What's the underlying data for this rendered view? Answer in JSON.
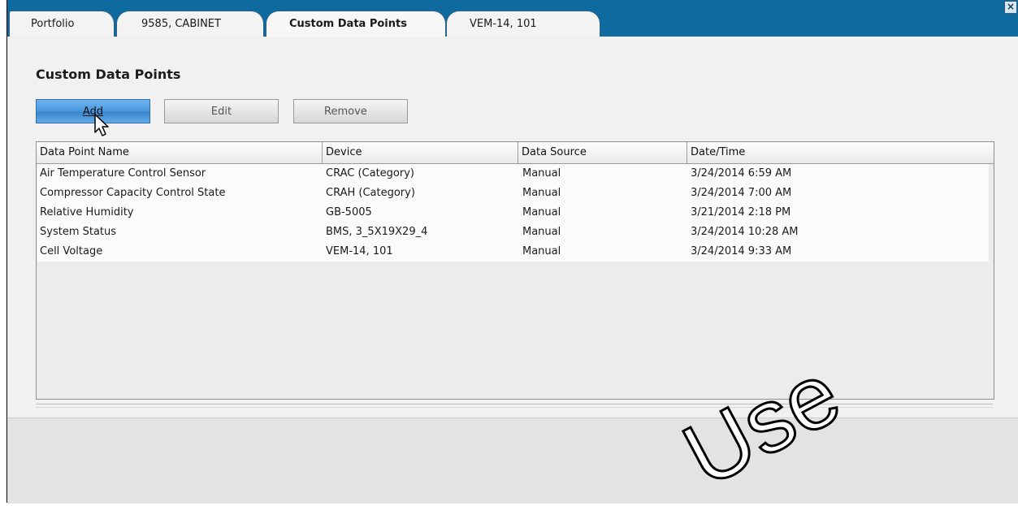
{
  "tabs": [
    {
      "label": "Portfolio",
      "active": false
    },
    {
      "label": "9585, CABINET",
      "active": false
    },
    {
      "label": "Custom Data Points",
      "active": true
    },
    {
      "label": "VEM-14, 101",
      "active": false
    }
  ],
  "close_label": "×",
  "section_title": "Custom Data Points",
  "buttons": {
    "add": "Add",
    "edit": "Edit",
    "remove": "Remove"
  },
  "table": {
    "columns": [
      "Data Point Name",
      "Device",
      "Data Source",
      "Date/Time"
    ],
    "rows": [
      [
        "Air Temperature Control Sensor",
        "CRAC (Category)",
        "Manual",
        "3/24/2014 6:59 AM"
      ],
      [
        "Compressor Capacity Control State",
        "CRAH (Category)",
        "Manual",
        "3/24/2014 7:00 AM"
      ],
      [
        "Relative Humidity",
        "GB-5005",
        "Manual",
        "3/21/2014 2:18 PM"
      ],
      [
        "System Status",
        "BMS, 3_5X19X29_4",
        "Manual",
        "3/24/2014 10:28 AM"
      ],
      [
        "Cell Voltage",
        "VEM-14, 101",
        "Manual",
        "3/24/2014 9:33 AM"
      ]
    ]
  },
  "watermark": "Use",
  "colors": {
    "tabbar": "#0f6aa0",
    "add_button": "#4e9ae0",
    "panel": "#f1f1f1"
  }
}
